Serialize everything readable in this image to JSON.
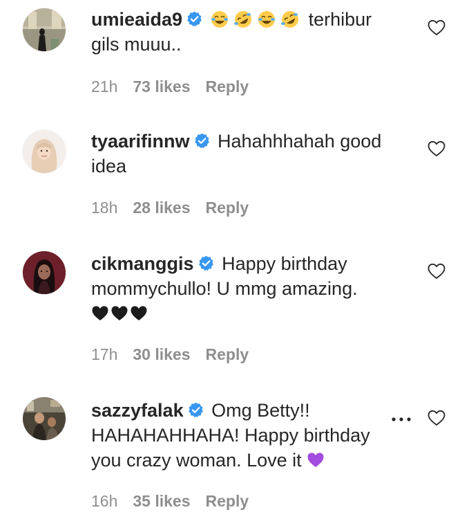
{
  "comments": [
    {
      "username": "umieaida9",
      "verified": true,
      "emoji": [
        "face-with-tears-of-joy",
        "rolling-on-the-floor-laughing",
        "face-with-tears-of-joy",
        "rolling-on-the-floor-laughing"
      ],
      "text": "terhibur gils muuu..",
      "time": "21h",
      "likes": "73 likes",
      "reply": "Reply"
    },
    {
      "username": "tyaarifinnw",
      "verified": true,
      "text": "Hahahhhahah good idea",
      "time": "18h",
      "likes": "28 likes",
      "reply": "Reply"
    },
    {
      "username": "cikmanggis",
      "verified": true,
      "text": "Happy birthday mommychullo! U mmg amazing.",
      "text_emoji": [
        "black-heart",
        "black-heart",
        "black-heart"
      ],
      "time": "17h",
      "likes": "30 likes",
      "reply": "Reply"
    },
    {
      "username": "sazzyfalak",
      "verified": true,
      "text": "Omg Betty!! HAHAHAHHAHA! Happy birthday you crazy woman. Love it",
      "text_emoji": [
        "purple-heart"
      ],
      "time": "16h",
      "likes": "35 likes",
      "reply": "Reply",
      "has_more_options": true
    }
  ],
  "icons": {
    "verified": "verified-badge-icon",
    "like": "heart-outline-icon",
    "more": "more-options-icon"
  },
  "colors": {
    "verified_blue": "#3897f0",
    "meta_gray": "#8e8e8e",
    "text": "#262626",
    "purple_heart": "#a24ce0"
  }
}
